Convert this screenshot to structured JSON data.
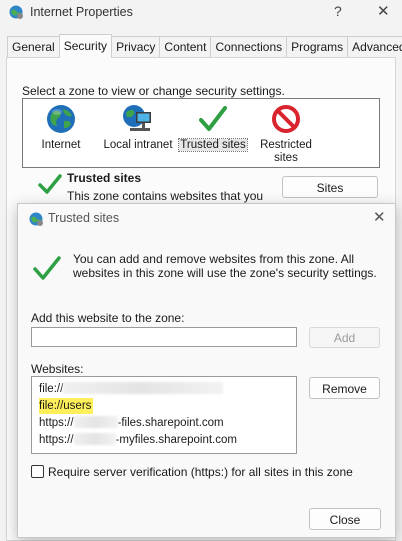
{
  "window": {
    "title": "Internet Properties",
    "help": "?",
    "close": "✕"
  },
  "tabs": [
    {
      "label": "General"
    },
    {
      "label": "Security"
    },
    {
      "label": "Privacy"
    },
    {
      "label": "Content"
    },
    {
      "label": "Connections"
    },
    {
      "label": "Programs"
    },
    {
      "label": "Advanced"
    }
  ],
  "security": {
    "prompt": "Select a zone to view or change security settings.",
    "zones": [
      {
        "label": "Internet",
        "icon": "globe-icon"
      },
      {
        "label": "Local intranet",
        "icon": "network-computer-icon"
      },
      {
        "label": "Trusted sites",
        "icon": "checkmark-icon",
        "selected": true
      },
      {
        "label": "Restricted sites",
        "icon": "prohibited-icon"
      }
    ],
    "zone_heading": "Trusted sites",
    "zone_desc": "This zone contains websites that you",
    "sites_button": "Sites"
  },
  "dialog": {
    "title": "Trusted sites",
    "close": "✕",
    "info": "You can add and remove websites from this zone. All websites in this zone will use the zone's security settings.",
    "add_label": "Add this website to the zone:",
    "add_value": "",
    "add_button": "Add",
    "websites_label": "Websites:",
    "websites": [
      {
        "prefix": "file://",
        "suffix": ""
      },
      {
        "prefix": "file://users",
        "suffix": ""
      },
      {
        "prefix": "https://",
        "suffix": "-files.sharepoint.com"
      },
      {
        "prefix": "https://",
        "suffix": "-myfiles.sharepoint.com"
      }
    ],
    "remove_button": "Remove",
    "verify_label": "Require server verification (https:) for all sites in this zone",
    "verify_checked": false,
    "close_button": "Close"
  },
  "colors": {
    "highlight": "#ffef5a",
    "check_green": "#2ea043"
  }
}
